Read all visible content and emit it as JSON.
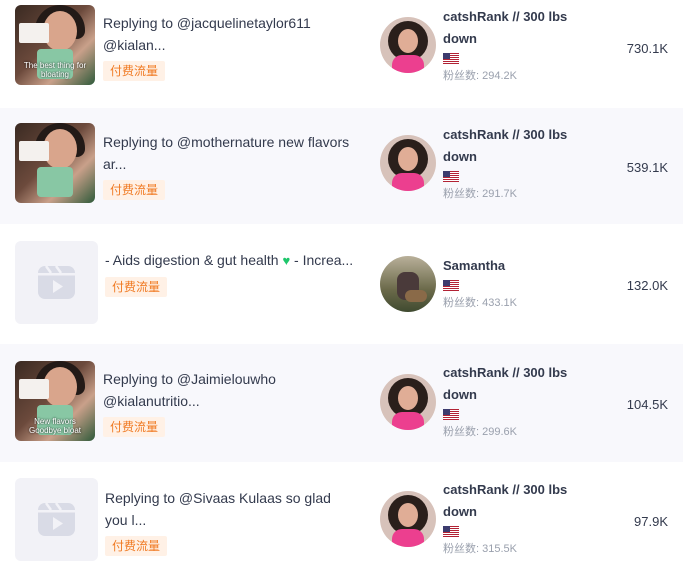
{
  "rows": [
    {
      "title": "Replying to @jacquelinetaylor611 @kialan...",
      "thumb_type": "photo",
      "thumb_caption": "The best thing for bloating",
      "tag": "付费流量",
      "creator": "catshRank // 300 lbs down",
      "country_flag_icon": "us-flag-icon",
      "fans": "粉丝数: 294.2K",
      "views": "730.1K"
    },
    {
      "title": "Replying to @mothernature new flavors ar...",
      "thumb_type": "photo",
      "thumb_caption": "",
      "tag": "付费流量",
      "creator": "catshRank // 300 lbs down",
      "country_flag_icon": "us-flag-icon",
      "fans": "粉丝数: 291.7K",
      "views": "539.1K"
    },
    {
      "title": "- Aids digestion & gut health",
      "title_suffix": " - Increa...",
      "heart_icon": "green-heart-icon",
      "thumb_type": "placeholder",
      "thumb_caption": "",
      "tag": "付费流量",
      "creator": "Samantha",
      "country_flag_icon": "us-flag-icon",
      "fans": "粉丝数: 433.1K",
      "views": "132.0K"
    },
    {
      "title": "Replying to @Jaimielouwho @kialanutritio...",
      "thumb_type": "photo",
      "thumb_caption": "New flavors Goodbye bloat",
      "tag": "付费流量",
      "creator": "catshRank // 300 lbs down",
      "country_flag_icon": "us-flag-icon",
      "fans": "粉丝数: 299.6K",
      "views": "104.5K"
    },
    {
      "title": "Replying to @Sivaas Kulaas so glad you l...",
      "thumb_type": "placeholder",
      "thumb_caption": "",
      "tag": "付费流量",
      "creator": "catshRank // 300 lbs down",
      "country_flag_icon": "us-flag-icon",
      "fans": "粉丝数: 315.5K",
      "views": "97.9K"
    }
  ],
  "colors": {
    "tag_bg": "#fff1e6",
    "tag_text": "#f07a23",
    "alt_row_bg": "#f8f8fc",
    "fans_text": "#9aa0ad",
    "heart": "#1ec66b"
  }
}
